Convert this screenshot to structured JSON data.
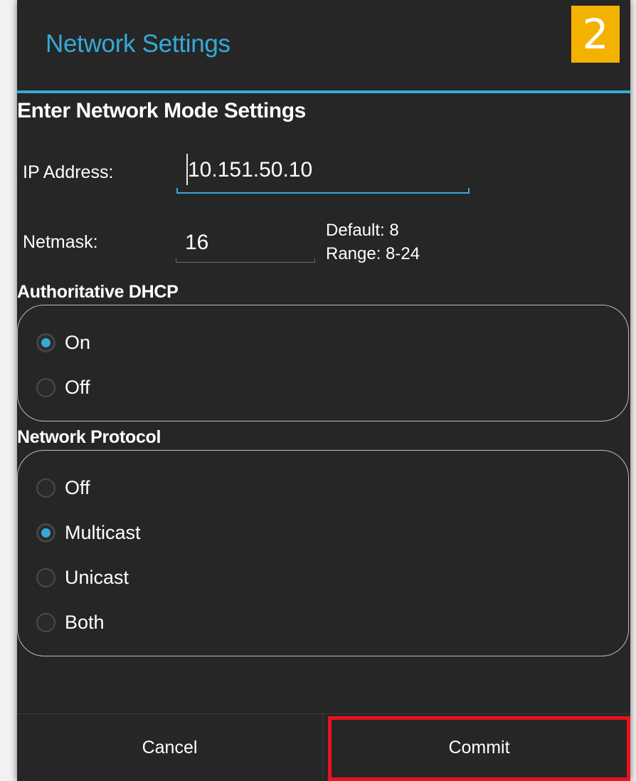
{
  "dialog": {
    "title": "Network Settings",
    "step_badge": "2",
    "section_heading": "Enter Network Mode Settings"
  },
  "ip_address": {
    "label": "IP Address:",
    "value": "10.151.50.10"
  },
  "netmask": {
    "label": "Netmask:",
    "value": "16",
    "default_hint": "Default: 8",
    "range_hint": "Range: 8-24"
  },
  "authoritative_dhcp": {
    "title": "Authoritative DHCP",
    "options": [
      {
        "label": "On",
        "selected": true
      },
      {
        "label": "Off",
        "selected": false
      }
    ]
  },
  "network_protocol": {
    "title": "Network Protocol",
    "options": [
      {
        "label": "Off",
        "selected": false
      },
      {
        "label": "Multicast",
        "selected": true
      },
      {
        "label": "Unicast",
        "selected": false
      },
      {
        "label": "Both",
        "selected": false
      }
    ]
  },
  "buttons": {
    "cancel": "Cancel",
    "commit": "Commit"
  },
  "colors": {
    "accent": "#35a9d9",
    "background": "#262626",
    "badge": "#f4b200",
    "highlight": "#e8141b"
  }
}
